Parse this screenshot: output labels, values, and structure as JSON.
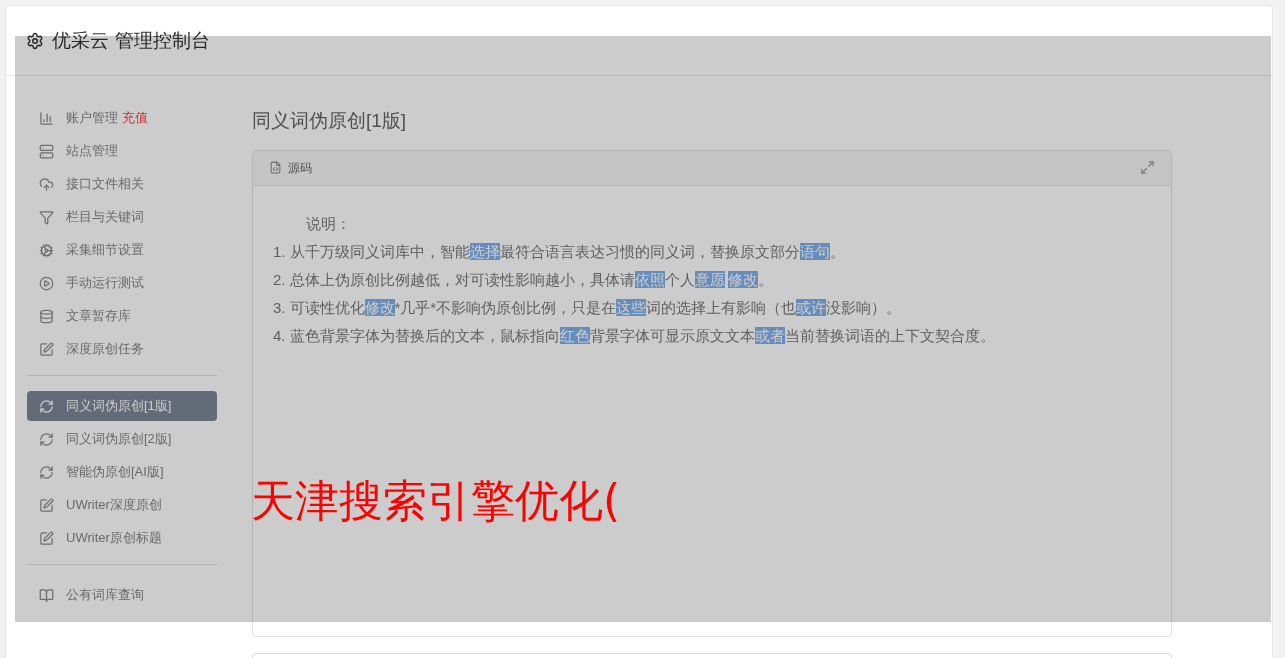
{
  "header": {
    "title": "优采云 管理控制台"
  },
  "sidebar": {
    "groups": [
      {
        "items": [
          {
            "label": "账户管理",
            "badge": "充值",
            "selected": false
          },
          {
            "label": "站点管理",
            "selected": false
          },
          {
            "label": "接口文件相关",
            "selected": false
          },
          {
            "label": "栏目与关键词",
            "selected": false
          },
          {
            "label": "采集细节设置",
            "selected": false
          },
          {
            "label": "手动运行测试",
            "selected": false
          },
          {
            "label": "文章暂存库",
            "selected": false
          },
          {
            "label": "深度原创任务",
            "selected": false
          }
        ]
      },
      {
        "items": [
          {
            "label": "同义词伪原创[1版]",
            "selected": true
          },
          {
            "label": "同义词伪原创[2版]",
            "selected": false
          },
          {
            "label": "智能伪原创[AI版]",
            "selected": false
          },
          {
            "label": "UWriter深度原创",
            "selected": false
          },
          {
            "label": "UWriter原创标题",
            "selected": false
          }
        ]
      },
      {
        "items": [
          {
            "label": "公有词库查询",
            "selected": false
          }
        ]
      }
    ]
  },
  "page_title": "同义词伪原创[1版]",
  "editor": {
    "toolbar_label": "源码",
    "heading": "说明：",
    "lines": [
      {
        "number": "1.",
        "segments": [
          {
            "text": "从千万级同义词库中，智能",
            "highlighted": false
          },
          {
            "text": "选择",
            "highlighted": true
          },
          {
            "text": "最符合语言表达习惯的同义词，替换原文部分",
            "highlighted": false
          },
          {
            "text": "语句",
            "highlighted": true
          },
          {
            "text": "。",
            "highlighted": false
          }
        ]
      },
      {
        "number": "2.",
        "segments": [
          {
            "text": "总体上伪原创比例越低，对可读性影响越小，具体请",
            "highlighted": false
          },
          {
            "text": "依照",
            "highlighted": true
          },
          {
            "text": "个人",
            "highlighted": false
          },
          {
            "text": "意愿",
            "highlighted": true
          },
          {
            "text": "修改",
            "highlighted": true
          },
          {
            "text": "。",
            "highlighted": false
          }
        ]
      },
      {
        "number": "3.",
        "segments": [
          {
            "text": "可读性优化",
            "highlighted": false
          },
          {
            "text": "修改",
            "highlighted": true
          },
          {
            "text": "*几乎*不影响伪原创比例，只是在",
            "highlighted": false
          },
          {
            "text": "这些",
            "highlighted": true
          },
          {
            "text": "词的选择上有影响（也",
            "highlighted": false
          },
          {
            "text": "或许",
            "highlighted": true
          },
          {
            "text": "没影响）。",
            "highlighted": false
          }
        ]
      },
      {
        "number": "4.",
        "segments": [
          {
            "text": "蓝色背景字体为替换后的文本，鼠标指向",
            "highlighted": false
          },
          {
            "text": "红色",
            "highlighted": true
          },
          {
            "text": "背景字体可显示原文文本",
            "highlighted": false
          },
          {
            "text": "或者",
            "highlighted": true
          },
          {
            "text": "当前替换词语的上下文契合度。",
            "highlighted": false
          }
        ]
      }
    ]
  },
  "overlay_text": "天津搜索引擎优化("
}
